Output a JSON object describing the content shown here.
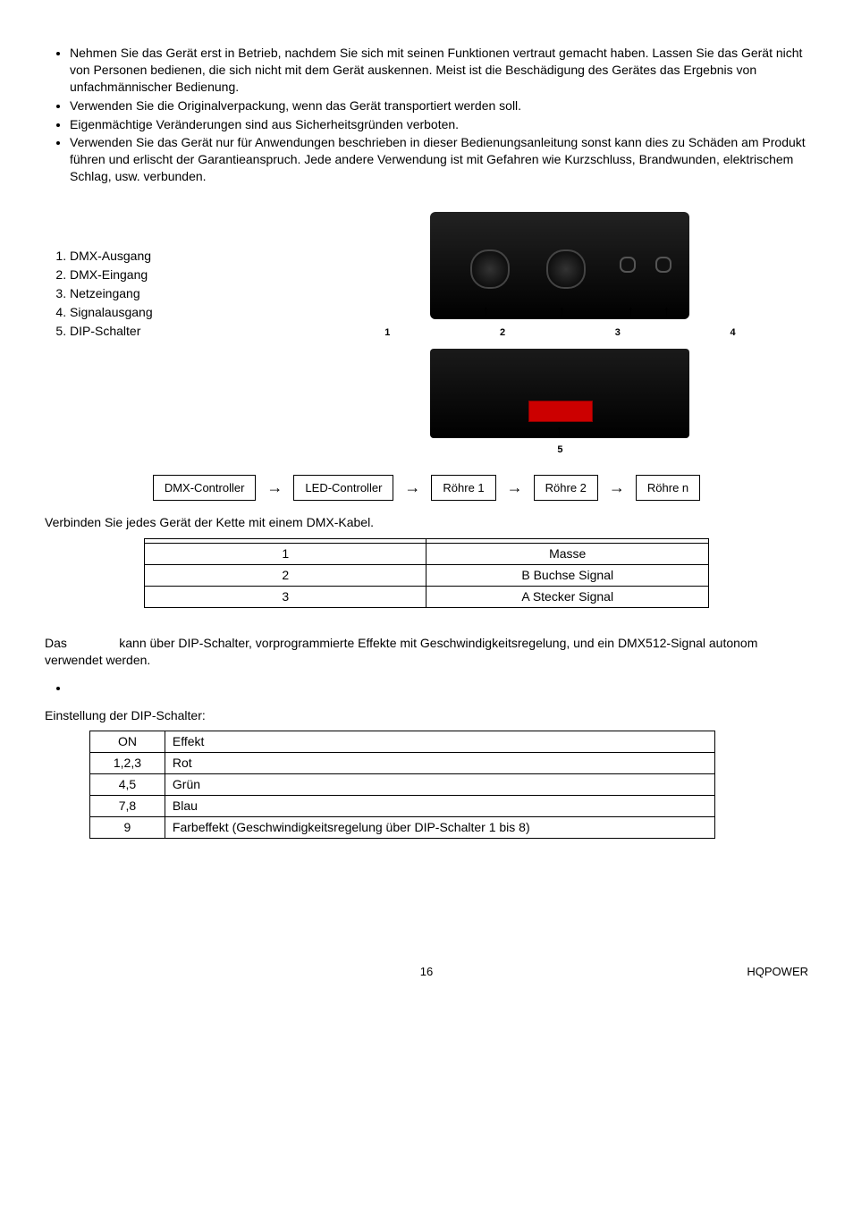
{
  "top_bullets": [
    "Nehmen Sie das Gerät erst in Betrieb, nachdem Sie sich mit seinen Funktionen vertraut gemacht haben. Lassen Sie das Gerät nicht von Personen bedienen, die sich nicht mit dem Gerät auskennen. Meist ist die Beschädigung des Gerätes das Ergebnis von unfachmännischer Bedienung.",
    "Verwenden Sie die Originalverpackung, wenn das Gerät transportiert werden soll.",
    "Eigenmächtige Veränderungen sind aus Sicherheitsgründen verboten.",
    "Verwenden Sie das Gerät nur für Anwendungen beschrieben in dieser Bedienungsanleitung   sonst kann dies zu Schäden am Produkt führen und erlischt der Garantieanspruch. Jede andere Verwendung ist mit Gefahren wie Kurzschluss, Brandwunden, elektrischem Schlag, usw. verbunden."
  ],
  "desc": {
    "items": [
      "DMX-Ausgang",
      "DMX-Eingang",
      "Netzeingang",
      "Signalausgang",
      "DIP-Schalter"
    ],
    "img_labels": [
      "1",
      "2",
      "3",
      "4"
    ],
    "img2_label": "5"
  },
  "flow": {
    "b1": "DMX-Controller",
    "b2": "LED-Controller",
    "b3": "Röhre 1",
    "b4": "Röhre 2",
    "b5": "Röhre n"
  },
  "verbinden": "Verbinden Sie jedes Gerät der Kette mit einem DMX-Kabel.",
  "pin_table": [
    [
      "1",
      "Masse"
    ],
    [
      "2",
      "B Buchse Signal"
    ],
    [
      "3",
      "A Stecker Signal"
    ]
  ],
  "usage_text_a": "Das",
  "usage_text_b": "kann über DIP-Schalter, vorprogrammierte Effekte mit Geschwindigkeitsregelung, und ein DMX512-Signal autonom verwendet werden.",
  "einstellung": "Einstellung der DIP-Schalter:",
  "dip_table": [
    [
      "ON",
      "Effekt"
    ],
    [
      "1,2,3",
      "Rot"
    ],
    [
      "4,5",
      "Grün"
    ],
    [
      "7,8",
      "Blau"
    ],
    [
      "9",
      "Farbeffekt (Geschwindigkeitsregelung über DIP-Schalter 1 bis 8)"
    ]
  ],
  "footer": {
    "page": "16",
    "brand": "HQPOWER"
  }
}
